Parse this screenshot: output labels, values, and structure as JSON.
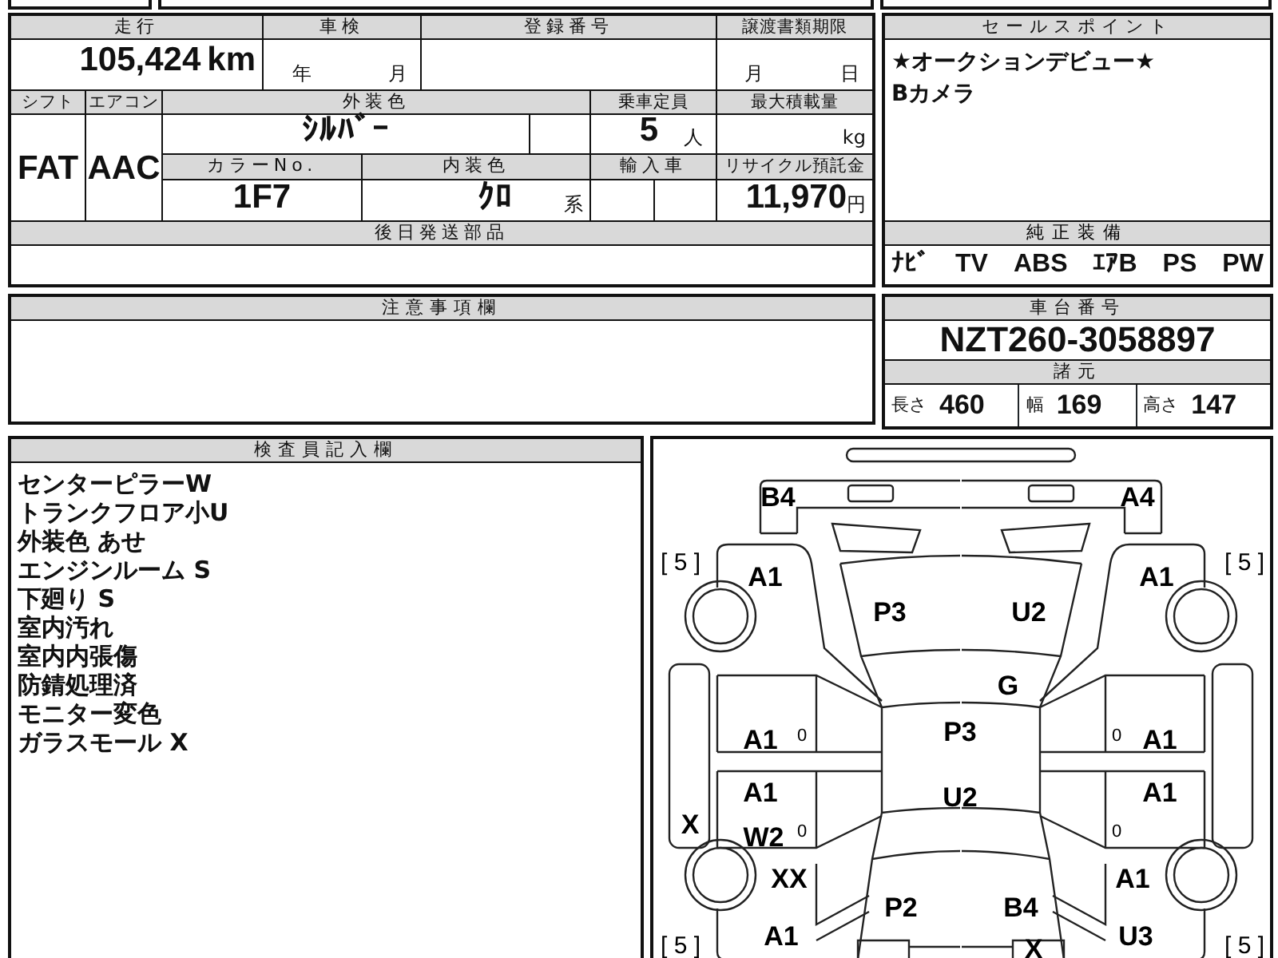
{
  "vehicle_info": {
    "mileage": {
      "label": "走行",
      "value": "105,424",
      "unit": "km"
    },
    "inspection": {
      "label": "車検",
      "year_unit": "年",
      "month_unit": "月"
    },
    "registration_number": {
      "label": "登録番号"
    },
    "transfer_deadline": {
      "label": "譲渡書類期限",
      "month_unit": "月",
      "day_unit": "日"
    },
    "shift": {
      "label": "シフト",
      "value": "FAT"
    },
    "air_conditioner": {
      "label": "エアコン",
      "value": "AAC"
    },
    "exterior_color": {
      "label": "外装色",
      "value": "ｼﾙﾊﾞｰ"
    },
    "capacity": {
      "label": "乗車定員",
      "value": "5",
      "unit": "人"
    },
    "max_load": {
      "label": "最大積載量",
      "unit": "kg"
    },
    "color_no": {
      "label": "カラーNo.",
      "value": "1F7"
    },
    "interior_color": {
      "label": "内装色",
      "value": "ｸﾛ",
      "suffix": "系"
    },
    "imported": {
      "label": "輸入車"
    },
    "recycle_deposit": {
      "label": "リサイクル預託金",
      "value": "11,970",
      "unit": "円"
    },
    "parts_later": {
      "label": "後日発送部品"
    }
  },
  "sales_points": {
    "title": "セールスポイント",
    "lines": [
      "★オークションデビュー★",
      "Bカメラ"
    ]
  },
  "equipment": {
    "title": "純正装備",
    "items": [
      "ﾅﾋﾞ",
      "TV",
      "ABS",
      "ｴｱB",
      "PS",
      "PW"
    ]
  },
  "notes": {
    "title": "注意事項欄"
  },
  "chassis": {
    "title": "車台番号",
    "number": "NZT260-3058897"
  },
  "specs": {
    "title": "諸元",
    "items": [
      {
        "label": "長さ",
        "value": "460"
      },
      {
        "label": "幅",
        "value": "169"
      },
      {
        "label": "高さ",
        "value": "147"
      }
    ]
  },
  "inspector_notes": {
    "title": "検査員記入欄",
    "lines": [
      "センターピラーW",
      "トランクフロア小U",
      "外装色 あせ",
      "エンジンルーム S",
      "下廻り S",
      "室内汚れ",
      "室内内張傷",
      "防錆処理済",
      "モニター変色",
      "ガラスモール X"
    ]
  },
  "damage_map": {
    "tire_treads": [
      "[ 5 ]",
      "[ 5 ]",
      "[ 5 ]",
      "[ 5 ]"
    ],
    "marks": [
      "B4",
      "A4",
      "A1",
      "A1",
      "P3",
      "U2",
      "G",
      "A1",
      "P3",
      "A1",
      "A1",
      "U2",
      "A1",
      "X",
      "W2",
      "XX",
      "A1",
      "P2",
      "B4",
      "A1",
      "U3",
      "X"
    ],
    "door_marks": [
      "0",
      "0",
      "0",
      "0"
    ]
  }
}
